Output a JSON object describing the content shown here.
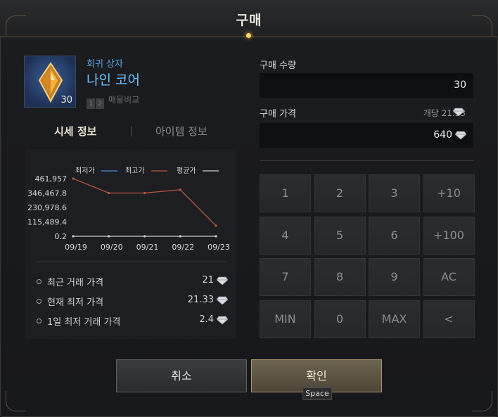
{
  "window": {
    "title": "구매"
  },
  "item": {
    "grade": "희귀 상자",
    "name": "나인 코어",
    "quantity_badge": "30",
    "compare_label": "매물비교",
    "compare_keys": [
      "1",
      "2"
    ],
    "icon": "crystal-icon"
  },
  "tabs": [
    {
      "label": "시세 정보",
      "active": true
    },
    {
      "label": "아이템 정보",
      "active": false
    }
  ],
  "chart_data": {
    "type": "line",
    "x": [
      "09/19",
      "09/20",
      "09/21",
      "09/22",
      "09/23"
    ],
    "yticks": [
      "461,957",
      "346,467.8",
      "230,978.6",
      "115,489.4",
      "0.2"
    ],
    "ylim": [
      0.2,
      461957
    ],
    "series": [
      {
        "name": "최저가",
        "color": "#4a90d9",
        "values": [
          null,
          null,
          null,
          null,
          null
        ]
      },
      {
        "name": "최고가",
        "color": "#b8573f",
        "values": [
          461957,
          346467.8,
          346467.8,
          373000,
          85000
        ]
      },
      {
        "name": "평균가",
        "color": "#cfcfcf",
        "values": [
          0.2,
          0.2,
          0.2,
          0.2,
          0.2
        ]
      }
    ]
  },
  "stats": [
    {
      "label": "최근 거래 가격",
      "value": "21"
    },
    {
      "label": "현재 최저 가격",
      "value": "21.33"
    },
    {
      "label": "1일 최저 거래 가격",
      "value": "2.4"
    }
  ],
  "purchase": {
    "qty_label": "구매 수량",
    "qty_value": "30",
    "price_label": "구매 가격",
    "unit_price": "개당 21.33",
    "price_value": "640"
  },
  "keypad": [
    [
      "1",
      "2",
      "3",
      "+10"
    ],
    [
      "4",
      "5",
      "6",
      "+100"
    ],
    [
      "7",
      "8",
      "9",
      "AC"
    ],
    [
      "MIN",
      "0",
      "MAX",
      "<"
    ]
  ],
  "buttons": {
    "cancel": "취소",
    "confirm": "확인",
    "confirm_hint": "Space"
  },
  "colors": {
    "accent_gold": "#f6d26a",
    "item_blue": "#6cc1ff",
    "confirm_border": "#a8976b"
  }
}
